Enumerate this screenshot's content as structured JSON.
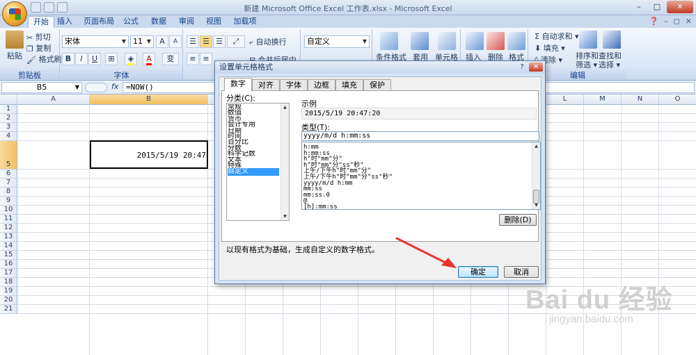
{
  "window": {
    "title": "新建 Microsoft Office Excel 工作表.xlsx - Microsoft Excel",
    "min": "–",
    "max": "□",
    "close": "✕",
    "doc_min": "–",
    "doc_restore": "◻",
    "doc_close": "✕"
  },
  "tabs": [
    "开始",
    "插入",
    "页面布局",
    "公式",
    "数据",
    "审阅",
    "视图",
    "加载项"
  ],
  "ribbon": {
    "clipboard": {
      "paste": "粘贴",
      "cut": "剪切",
      "copy": "复制",
      "painter": "格式刷",
      "label": "剪贴板"
    },
    "font": {
      "name": "宋体",
      "size": "11",
      "bold": "B",
      "italic": "I",
      "underline": "U",
      "grow": "A",
      "shrink": "A",
      "label": "字体",
      "color": "A",
      "wen": "变"
    },
    "alignment": {
      "wrap": "自动换行",
      "merge": "合并后居中"
    },
    "number": {
      "format": "自定义"
    },
    "styles": {
      "conditional": "条件格式",
      "table": "套用",
      "cell": "单元格"
    },
    "cells": {
      "insert": "插入",
      "delete": "删除",
      "format": "格式"
    },
    "editing": {
      "autosum": "自动求和",
      "fill": "填充",
      "clear": "清除",
      "sort": "排序和",
      "sort2": "筛选",
      "find": "查找和",
      "find2": "选择",
      "label": "编辑"
    },
    "colors": {
      "accent": "#15428b",
      "ribbon_bg": "#dde8f6"
    }
  },
  "formula_bar": {
    "name_box": "B5",
    "fx": "fx",
    "formula": "=NOW()"
  },
  "grid": {
    "columns": [
      "A",
      "B",
      "C",
      "D",
      "E",
      "F",
      "G",
      "H",
      "I",
      "J",
      "K",
      "L",
      "M",
      "N",
      "O"
    ],
    "rows": [
      "1",
      "2",
      "3",
      "4",
      "5",
      "6",
      "7",
      "8",
      "9",
      "10",
      "11",
      "12",
      "13",
      "14",
      "15",
      "16",
      "17",
      "18",
      "19",
      "20",
      "21"
    ],
    "selected_cell": "B5",
    "cell_value": "2015/5/19 20:47"
  },
  "dialog": {
    "title": "设置单元格格式",
    "help": "?",
    "close": "✕",
    "tabs": [
      "数字",
      "对齐",
      "字体",
      "边框",
      "填充",
      "保护"
    ],
    "category_label": "分类(C):",
    "categories": [
      "常规",
      "数值",
      "货币",
      "会计专用",
      "日期",
      "时间",
      "百分比",
      "分数",
      "科学记数",
      "文本",
      "特殊",
      "自定义"
    ],
    "selected_category": "自定义",
    "sample_label": "示例",
    "sample_value": "2015/5/19 20:47:20",
    "type_label": "类型(T):",
    "type_value": "yyyy/m/d h:mm:ss",
    "formats": [
      "h:mm",
      "h:mm:ss",
      "h\"时\"mm\"分\"",
      "h\"时\"mm\"分\"ss\"秒\"",
      "上午/下午h\"时\"mm\"分\"",
      "上午/下午h\"时\"mm\"分\"ss\"秒\"",
      "yyyy/m/d h:mm",
      "mm:ss",
      "mm:ss.0",
      "@",
      "[h]:mm:ss"
    ],
    "delete_button": "删除(D)",
    "hint": "以现有格式为基础，生成自定义的数字格式。",
    "ok": "确定",
    "cancel": "取消"
  },
  "watermark": {
    "logo": "Bai du 经验",
    "url": "jingyan.baidu.com"
  },
  "annotation": {
    "arrow_color": "#e8322a"
  }
}
